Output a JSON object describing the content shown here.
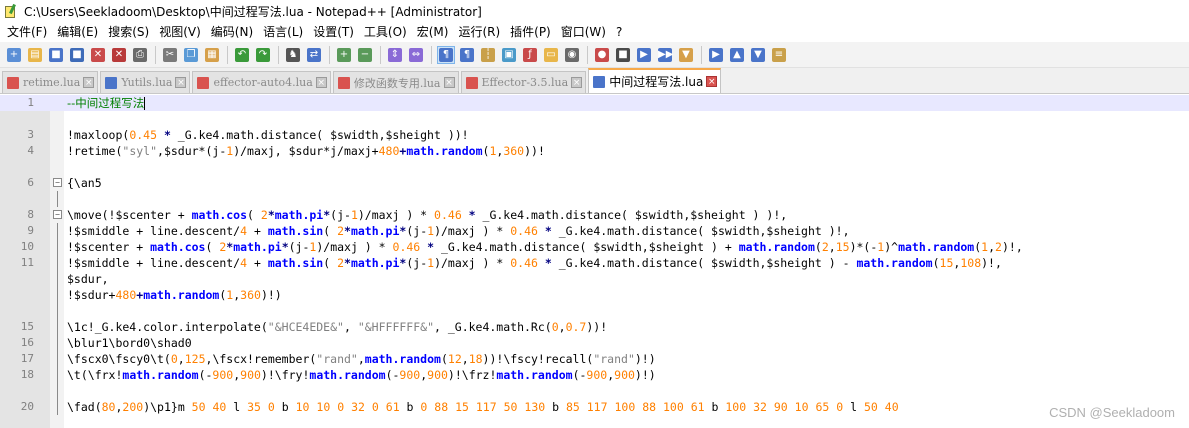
{
  "window": {
    "title": "C:\\Users\\Seekladoom\\Desktop\\中间过程写法.lua - Notepad++ [Administrator]"
  },
  "menu": [
    "文件(F)",
    "编辑(E)",
    "搜索(S)",
    "视图(V)",
    "编码(N)",
    "语言(L)",
    "设置(T)",
    "工具(O)",
    "宏(M)",
    "运行(R)",
    "插件(P)",
    "窗口(W)",
    "?"
  ],
  "toolbar": {
    "icons": [
      "new-file",
      "open-file",
      "save",
      "save-all",
      "close",
      "close-all",
      "print",
      "cut",
      "copy",
      "paste",
      "undo",
      "redo",
      "find",
      "replace",
      "zoom-in",
      "zoom-out",
      "sync-vertical",
      "sync-horizontal",
      "word-wrap",
      "all-characters",
      "indent-guide",
      "doc-map",
      "function-list",
      "folder-workspace",
      "monitoring",
      "record-macro",
      "stop-record",
      "play-macro",
      "run-macro-multiple",
      "save-macro",
      "bookmark",
      "move-up",
      "move-down",
      "show-panel"
    ]
  },
  "tabs": [
    {
      "label": "retime.lua",
      "active": false,
      "color": "#d9534f"
    },
    {
      "label": "Yutils.lua",
      "active": false,
      "color": "#4a74c9"
    },
    {
      "label": "effector-auto4.lua",
      "active": false,
      "color": "#d9534f"
    },
    {
      "label": "修改函数专用.lua",
      "active": false,
      "color": "#d9534f"
    },
    {
      "label": "Effector-3.5.lua",
      "active": false,
      "color": "#d9534f"
    },
    {
      "label": "中间过程写法.lua",
      "active": true,
      "color": "#4a74c9"
    }
  ],
  "editor": {
    "line_numbers": [
      "1",
      "",
      "3",
      "4",
      "",
      "6",
      "",
      "8",
      "9",
      "10",
      "11",
      "",
      "",
      "",
      "15",
      "16",
      "17",
      "18",
      "",
      "20"
    ],
    "code": {
      "l1": "--中间过程写法",
      "l3": [
        [
          "t",
          "!maxloop("
        ],
        [
          "n",
          "0.45"
        ],
        [
          "o",
          " * "
        ],
        [
          "t",
          "_G.ke4.math.distance( $swidth,$sheight ))!"
        ]
      ],
      "l4": [
        [
          "t",
          "!retime("
        ],
        [
          "s",
          "\"syl\""
        ],
        [
          "t",
          ",$sdur*(j-"
        ],
        [
          "n",
          "1"
        ],
        [
          "t",
          ")/maxj, $sdur*j/maxj+"
        ],
        [
          "n",
          "480"
        ],
        [
          "o",
          "+"
        ],
        [
          "k",
          "math.random"
        ],
        [
          "t",
          "("
        ],
        [
          "n",
          "1"
        ],
        [
          "t",
          ","
        ],
        [
          "n",
          "360"
        ],
        [
          "t",
          "))!"
        ]
      ],
      "l6": "{\\an5",
      "l8": [
        [
          "t",
          "\\move(!$scenter + "
        ],
        [
          "k",
          "math.cos"
        ],
        [
          "t",
          "( "
        ],
        [
          "n",
          "2"
        ],
        [
          "o",
          "*"
        ],
        [
          "k",
          "math.pi"
        ],
        [
          "o",
          "*"
        ],
        [
          "t",
          "(j-"
        ],
        [
          "n",
          "1"
        ],
        [
          "t",
          ")/maxj ) * "
        ],
        [
          "n",
          "0.46"
        ],
        [
          "o",
          " * "
        ],
        [
          "t",
          "_G.ke4.math.distance( $swidth,$sheight ) )!,"
        ]
      ],
      "l9": [
        [
          "t",
          "!$smiddle + line.descent/"
        ],
        [
          "n",
          "4"
        ],
        [
          "t",
          " + "
        ],
        [
          "k",
          "math.sin"
        ],
        [
          "t",
          "( "
        ],
        [
          "n",
          "2"
        ],
        [
          "o",
          "*"
        ],
        [
          "k",
          "math.pi"
        ],
        [
          "o",
          "*"
        ],
        [
          "t",
          "(j-"
        ],
        [
          "n",
          "1"
        ],
        [
          "t",
          ")/maxj ) * "
        ],
        [
          "n",
          "0.46"
        ],
        [
          "o",
          " * "
        ],
        [
          "t",
          "_G.ke4.math.distance( $swidth,$sheight )!,"
        ]
      ],
      "l10": [
        [
          "t",
          "!$scenter + "
        ],
        [
          "k",
          "math.cos"
        ],
        [
          "t",
          "( "
        ],
        [
          "n",
          "2"
        ],
        [
          "o",
          "*"
        ],
        [
          "k",
          "math.pi"
        ],
        [
          "o",
          "*"
        ],
        [
          "t",
          "(j-"
        ],
        [
          "n",
          "1"
        ],
        [
          "t",
          ")/maxj ) * "
        ],
        [
          "n",
          "0.46"
        ],
        [
          "o",
          " * "
        ],
        [
          "t",
          "_G.ke4.math.distance( $swidth,$sheight ) + "
        ],
        [
          "k",
          "math.random"
        ],
        [
          "t",
          "("
        ],
        [
          "n",
          "2"
        ],
        [
          "t",
          ","
        ],
        [
          "n",
          "15"
        ],
        [
          "t",
          ")*(-"
        ],
        [
          "n",
          "1"
        ],
        [
          "t",
          ")^"
        ],
        [
          "k",
          "math.random"
        ],
        [
          "t",
          "("
        ],
        [
          "n",
          "1"
        ],
        [
          "t",
          ","
        ],
        [
          "n",
          "2"
        ],
        [
          "t",
          ")!,"
        ]
      ],
      "l11": [
        [
          "t",
          "!$smiddle + line.descent/"
        ],
        [
          "n",
          "4"
        ],
        [
          "t",
          " + "
        ],
        [
          "k",
          "math.sin"
        ],
        [
          "t",
          "( "
        ],
        [
          "n",
          "2"
        ],
        [
          "o",
          "*"
        ],
        [
          "k",
          "math.pi"
        ],
        [
          "o",
          "*"
        ],
        [
          "t",
          "(j-"
        ],
        [
          "n",
          "1"
        ],
        [
          "t",
          ")/maxj ) * "
        ],
        [
          "n",
          "0.46"
        ],
        [
          "o",
          " * "
        ],
        [
          "t",
          "_G.ke4.math.distance( $swidth,$sheight ) - "
        ],
        [
          "k",
          "math.random"
        ],
        [
          "t",
          "("
        ],
        [
          "n",
          "15"
        ],
        [
          "t",
          ","
        ],
        [
          "n",
          "108"
        ],
        [
          "t",
          ")!,"
        ]
      ],
      "l11b": "$sdur,",
      "l11c": [
        [
          "t",
          "!$sdur+"
        ],
        [
          "n",
          "480"
        ],
        [
          "o",
          "+"
        ],
        [
          "k",
          "math.random"
        ],
        [
          "t",
          "("
        ],
        [
          "n",
          "1"
        ],
        [
          "t",
          ","
        ],
        [
          "n",
          "360"
        ],
        [
          "t",
          ")!)"
        ]
      ],
      "l15": [
        [
          "t",
          "\\1c!_G.ke4.color.interpolate("
        ],
        [
          "s",
          "\"&HCE4EDE&\""
        ],
        [
          "t",
          ", "
        ],
        [
          "s",
          "\"&HFFFFFF&\""
        ],
        [
          "t",
          ", _G.ke4.math.Rc("
        ],
        [
          "n",
          "0"
        ],
        [
          "t",
          ","
        ],
        [
          "n",
          "0.7"
        ],
        [
          "t",
          "))!"
        ]
      ],
      "l16": "\\blur1\\bord0\\shad0",
      "l17": [
        [
          "t",
          "\\fscx0\\fscy0\\t("
        ],
        [
          "n",
          "0"
        ],
        [
          "t",
          ","
        ],
        [
          "n",
          "125"
        ],
        [
          "t",
          ",\\fscx!remember("
        ],
        [
          "s",
          "\"rand\""
        ],
        [
          "t",
          ","
        ],
        [
          "k",
          "math.random"
        ],
        [
          "t",
          "("
        ],
        [
          "n",
          "12"
        ],
        [
          "t",
          ","
        ],
        [
          "n",
          "18"
        ],
        [
          "t",
          "))!\\fscy!recall("
        ],
        [
          "s",
          "\"rand\""
        ],
        [
          "t",
          ")!)"
        ]
      ],
      "l18": [
        [
          "t",
          "\\t(\\frx!"
        ],
        [
          "k",
          "math.random"
        ],
        [
          "t",
          "(-"
        ],
        [
          "n",
          "900"
        ],
        [
          "t",
          ","
        ],
        [
          "n",
          "900"
        ],
        [
          "t",
          ")!\\fry!"
        ],
        [
          "k",
          "math.random"
        ],
        [
          "t",
          "(-"
        ],
        [
          "n",
          "900"
        ],
        [
          "t",
          ","
        ],
        [
          "n",
          "900"
        ],
        [
          "t",
          ")!\\frz!"
        ],
        [
          "k",
          "math.random"
        ],
        [
          "t",
          "(-"
        ],
        [
          "n",
          "900"
        ],
        [
          "t",
          ","
        ],
        [
          "n",
          "900"
        ],
        [
          "t",
          ")!)"
        ]
      ],
      "l20": [
        [
          "t",
          "\\fad("
        ],
        [
          "n",
          "80"
        ],
        [
          "t",
          ","
        ],
        [
          "n",
          "200"
        ],
        [
          "t",
          ")\\p1}m "
        ],
        [
          "n",
          "50"
        ],
        [
          "t",
          " "
        ],
        [
          "n",
          "40"
        ],
        [
          "t",
          " l "
        ],
        [
          "n",
          "35"
        ],
        [
          "t",
          " "
        ],
        [
          "n",
          "0"
        ],
        [
          "t",
          " b "
        ],
        [
          "n",
          "10"
        ],
        [
          "t",
          " "
        ],
        [
          "n",
          "10"
        ],
        [
          "t",
          " "
        ],
        [
          "n",
          "0"
        ],
        [
          "t",
          " "
        ],
        [
          "n",
          "32"
        ],
        [
          "t",
          " "
        ],
        [
          "n",
          "0"
        ],
        [
          "t",
          " "
        ],
        [
          "n",
          "61"
        ],
        [
          "t",
          " b "
        ],
        [
          "n",
          "0"
        ],
        [
          "t",
          " "
        ],
        [
          "n",
          "88"
        ],
        [
          "t",
          " "
        ],
        [
          "n",
          "15"
        ],
        [
          "t",
          " "
        ],
        [
          "n",
          "117"
        ],
        [
          "t",
          " "
        ],
        [
          "n",
          "50"
        ],
        [
          "t",
          " "
        ],
        [
          "n",
          "130"
        ],
        [
          "t",
          " b "
        ],
        [
          "n",
          "85"
        ],
        [
          "t",
          " "
        ],
        [
          "n",
          "117"
        ],
        [
          "t",
          " "
        ],
        [
          "n",
          "100"
        ],
        [
          "t",
          " "
        ],
        [
          "n",
          "88"
        ],
        [
          "t",
          " "
        ],
        [
          "n",
          "100"
        ],
        [
          "t",
          " "
        ],
        [
          "n",
          "61"
        ],
        [
          "t",
          " b "
        ],
        [
          "n",
          "100"
        ],
        [
          "t",
          " "
        ],
        [
          "n",
          "32"
        ],
        [
          "t",
          " "
        ],
        [
          "n",
          "90"
        ],
        [
          "t",
          " "
        ],
        [
          "n",
          "10"
        ],
        [
          "t",
          " "
        ],
        [
          "n",
          "65"
        ],
        [
          "t",
          " "
        ],
        [
          "n",
          "0"
        ],
        [
          "t",
          " l "
        ],
        [
          "n",
          "50"
        ],
        [
          "t",
          " "
        ],
        [
          "n",
          "40"
        ]
      ]
    }
  },
  "watermark": "CSDN @Seekladoom"
}
